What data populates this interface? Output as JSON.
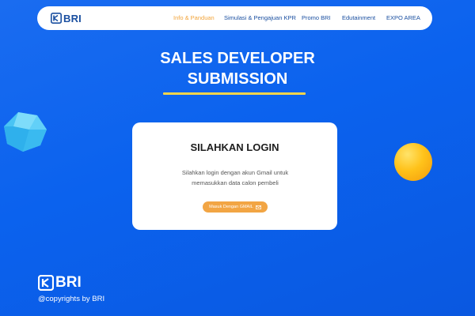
{
  "header": {
    "brand": "BRI",
    "nav": [
      {
        "label": "Info & Panduan",
        "active": true
      },
      {
        "label": "Simulasi & Pengajuan KPR",
        "active": false
      },
      {
        "label": "Promo BRI",
        "active": false
      },
      {
        "label": "Edutainment",
        "active": false
      },
      {
        "label": "EXPO AREA",
        "active": false
      }
    ]
  },
  "hero": {
    "title_line1": "SALES DEVELOPER",
    "title_line2": "SUBMISSION"
  },
  "login": {
    "title": "SILAHKAN LOGIN",
    "desc_line1": "Silahkan login dengan akun Gmail untuk",
    "desc_line2": "memasukkan data calon pembeli",
    "button_label": "Masuk Dengan GMAIL",
    "button_icon": "mail-icon"
  },
  "footer": {
    "brand": "BRI",
    "copyright": "@copyrights by BRI"
  },
  "colors": {
    "background": "#0b62ee",
    "accent": "#f2a544",
    "underline": "#f7d54a",
    "brand_blue": "#1a4fa0"
  }
}
